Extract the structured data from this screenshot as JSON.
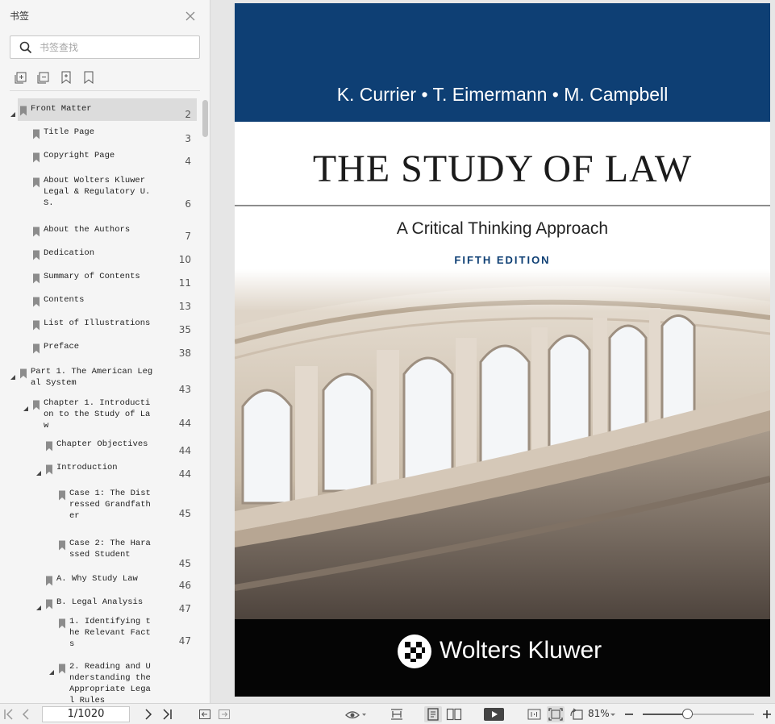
{
  "sidebar": {
    "title": "书签",
    "search_placeholder": "书签查找",
    "items": [
      {
        "label": "Front Matter",
        "page": "2"
      },
      {
        "label": "Title Page",
        "page": "3"
      },
      {
        "label": "Copyright Page",
        "page": "4"
      },
      {
        "label": "About Wolters Kluwer\nLegal & Regulatory U.\nS.",
        "page": "6"
      },
      {
        "label": "About the Authors",
        "page": "7"
      },
      {
        "label": "Dedication",
        "page": "10"
      },
      {
        "label": "Summary of Contents",
        "page": "11"
      },
      {
        "label": "Contents",
        "page": "13"
      },
      {
        "label": "List of Illustrations",
        "page": "35"
      },
      {
        "label": "Preface",
        "page": "38"
      },
      {
        "label": "Part 1. The American Leg\nal System",
        "page": "43"
      },
      {
        "label": "Chapter 1. Introducti\non to the Study of La\nw",
        "page": "44"
      },
      {
        "label": "Chapter Objectives",
        "page": "44"
      },
      {
        "label": "Introduction",
        "page": "44"
      },
      {
        "label": "Case 1: The Dist\nressed Grandfath\ner",
        "page": "45"
      },
      {
        "label": "Case 2: The Hara\nssed Student",
        "page": "45"
      },
      {
        "label": "A. Why Study Law",
        "page": "46"
      },
      {
        "label": "B. Legal Analysis",
        "page": "47"
      },
      {
        "label": "1. Identifying t\nhe Relevant Fact\ns",
        "page": "47"
      },
      {
        "label": "2. Reading and U\nnderstanding the\nAppropriate Lega\nl Rules",
        "page": ""
      }
    ]
  },
  "cover": {
    "authors": "K. Currier • T. Eimermann • M. Campbell",
    "title": "THE STUDY OF LAW",
    "subtitle": "A Critical Thinking Approach",
    "edition": "FIFTH EDITION",
    "publisher": "Wolters Kluwer"
  },
  "statusbar": {
    "page_indicator": "1/1020",
    "zoom": "81%",
    "zoom_fraction": 0.4
  },
  "colors": {
    "cover_blue": "#0e3f74",
    "cover_black": "#050505",
    "sidebar_bg": "#f5f5f5",
    "selected_row": "#dcdcdc"
  }
}
